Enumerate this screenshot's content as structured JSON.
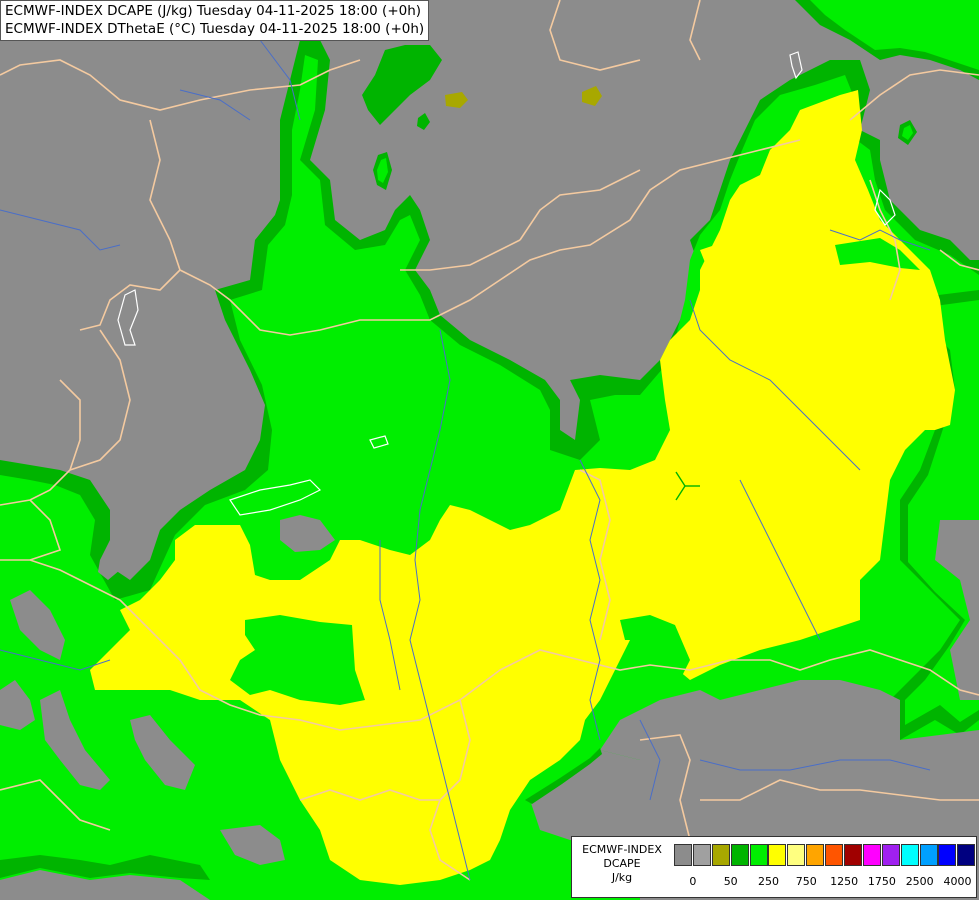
{
  "header": {
    "line1": "ECMWF-INDEX DCAPE (J/kg) Tuesday 04-11-2025 18:00 (+0h)",
    "line2": "ECMWF-INDEX DThetaE (°C) Tuesday 04-11-2025 18:00 (+0h)"
  },
  "colors": {
    "background": "#8c8c8c",
    "dark_green": "#00b400",
    "light_green": "#00ee00",
    "yellow": "#ffff00",
    "olive": "#a8a800",
    "border_line": "#f4caa0",
    "river_line": "#4a6ec8",
    "coast_line": "#ffffff"
  },
  "legend": {
    "line1": "ECMWF-INDEX",
    "line2": "DCAPE",
    "line3": "J/kg",
    "swatches": [
      "#8c8c8c",
      "#a0a0a0",
      "#a8a800",
      "#00b400",
      "#00ee00",
      "#ffff00",
      "#ffff80",
      "#ffa500",
      "#ff5500",
      "#a00000",
      "#ff00ff",
      "#a020f0",
      "#00ffff",
      "#00a0ff",
      "#0000ff",
      "#000080"
    ],
    "ticks": [
      "0",
      "50",
      "250",
      "750",
      "1250",
      "1750",
      "2500",
      "4000"
    ]
  }
}
